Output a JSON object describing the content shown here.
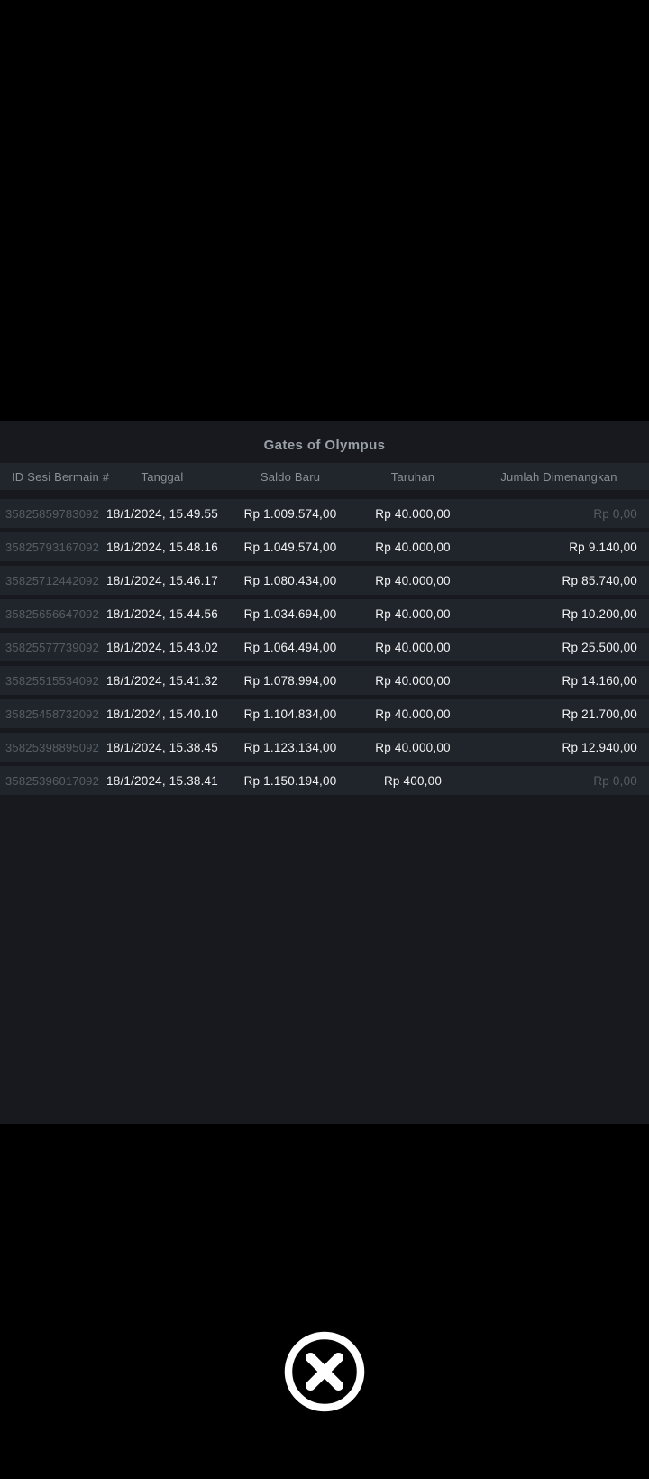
{
  "modal": {
    "title": "Gates of Olympus",
    "table": {
      "columns": [
        {
          "key": "id",
          "label": "ID Sesi Bermain #"
        },
        {
          "key": "date",
          "label": "Tanggal"
        },
        {
          "key": "balance",
          "label": "Saldo Baru"
        },
        {
          "key": "bet",
          "label": "Taruhan"
        },
        {
          "key": "win",
          "label": "Jumlah Dimenangkan"
        }
      ],
      "rows": [
        {
          "id": "35825859783092",
          "date": "18/1/2024, 15.49.55",
          "balance": "Rp 1.009.574,00",
          "bet": "Rp 40.000,00",
          "win": "Rp 0,00",
          "win_muted": true
        },
        {
          "id": "35825793167092",
          "date": "18/1/2024, 15.48.16",
          "balance": "Rp 1.049.574,00",
          "bet": "Rp 40.000,00",
          "win": "Rp 9.140,00",
          "win_muted": false
        },
        {
          "id": "35825712442092",
          "date": "18/1/2024, 15.46.17",
          "balance": "Rp 1.080.434,00",
          "bet": "Rp 40.000,00",
          "win": "Rp 85.740,00",
          "win_muted": false
        },
        {
          "id": "35825656647092",
          "date": "18/1/2024, 15.44.56",
          "balance": "Rp 1.034.694,00",
          "bet": "Rp 40.000,00",
          "win": "Rp 10.200,00",
          "win_muted": false
        },
        {
          "id": "35825577739092",
          "date": "18/1/2024, 15.43.02",
          "balance": "Rp 1.064.494,00",
          "bet": "Rp 40.000,00",
          "win": "Rp 25.500,00",
          "win_muted": false
        },
        {
          "id": "35825515534092",
          "date": "18/1/2024, 15.41.32",
          "balance": "Rp 1.078.994,00",
          "bet": "Rp 40.000,00",
          "win": "Rp 14.160,00",
          "win_muted": false
        },
        {
          "id": "35825458732092",
          "date": "18/1/2024, 15.40.10",
          "balance": "Rp 1.104.834,00",
          "bet": "Rp 40.000,00",
          "win": "Rp 21.700,00",
          "win_muted": false
        },
        {
          "id": "35825398895092",
          "date": "18/1/2024, 15.38.45",
          "balance": "Rp 1.123.134,00",
          "bet": "Rp 40.000,00",
          "win": "Rp 12.940,00",
          "win_muted": false
        },
        {
          "id": "35825396017092",
          "date": "18/1/2024, 15.38.41",
          "balance": "Rp 1.150.194,00",
          "bet": "Rp 400,00",
          "win": "Rp 0,00",
          "win_muted": true
        }
      ]
    }
  },
  "close_button": {
    "icon": "x-circle-icon"
  },
  "colors": {
    "background": "#000000",
    "panel": "#17191e",
    "row_band": "#20252b",
    "header_band": "#21262c",
    "text_primary": "#f3f4f5",
    "text_muted": "#575d64",
    "text_header": "#8a9097",
    "title": "#99a0a8",
    "close_icon": "#ffffff"
  }
}
